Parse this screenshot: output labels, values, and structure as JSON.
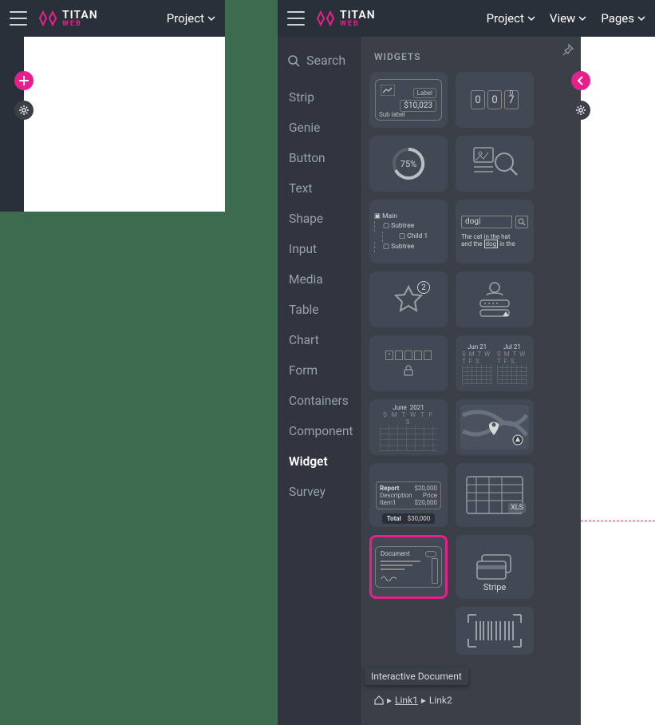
{
  "brand": {
    "name": "TITAN",
    "sub": "WEB"
  },
  "menus": {
    "project": "Project",
    "view": "View",
    "pages": "Pages"
  },
  "sidebar": {
    "search": "Search",
    "cats": [
      "Strip",
      "Genie",
      "Button",
      "Text",
      "Shape",
      "Input",
      "Media",
      "Table",
      "Chart",
      "Form",
      "Containers",
      "Component",
      "Widget",
      "Survey"
    ],
    "active": "Widget"
  },
  "panel": {
    "title": "WIDGETS",
    "tooltip": "Interactive Document"
  },
  "tiles": {
    "metric": {
      "label": "Label",
      "value": "$10,023",
      "sub": "Sub label"
    },
    "odometer": {
      "d1": "0",
      "d2": "0",
      "d3": "7",
      "frac": "0"
    },
    "gauge": {
      "pct": "75%"
    },
    "tree": {
      "root": "Main",
      "n1": "Subtree",
      "n2": "Child 1",
      "n3": "Subtree"
    },
    "search": {
      "term": "dog",
      "line1": "The cat in the hat",
      "line2_a": "and the ",
      "line2_b": "dog",
      "line2_c": " in the"
    },
    "rating": {
      "badge": "2"
    },
    "calheader": {
      "m1": "Jun 21",
      "m2": "Jul 21",
      "days": "S M T W T F S"
    },
    "monthcal": {
      "month": "June",
      "year": "2021",
      "days": "S M T W T F S"
    },
    "report": {
      "title": "Report",
      "amount": "$20,000",
      "l1a": "Description",
      "l1b": "Price",
      "l2a": "Item1",
      "l2b": "$20,000",
      "tot": "Total",
      "totv": "$30,000"
    },
    "xls": {
      "label": "XLS"
    },
    "doc": {
      "title": "Document"
    },
    "stripe": {
      "label": "Stripe"
    }
  },
  "crumb": {
    "l1": "Link1",
    "l2": "Link2",
    "sep": "▸"
  }
}
